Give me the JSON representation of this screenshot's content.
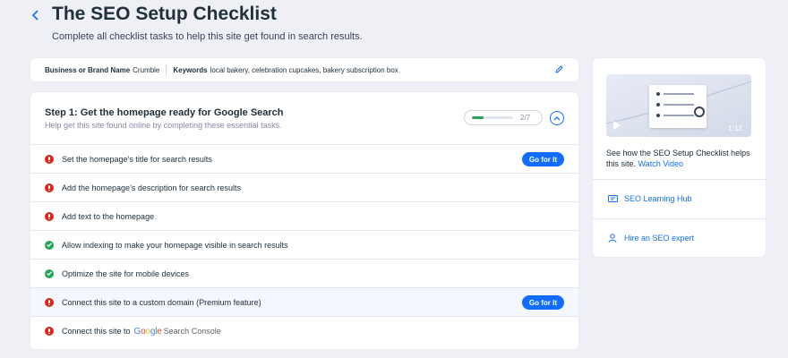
{
  "header": {
    "title": "The SEO Setup Checklist",
    "subtitle": "Complete all checklist tasks to help this site get found in search results."
  },
  "info_bar": {
    "brand_label": "Business or Brand Name",
    "brand_value": "Crumble",
    "keywords_label": "Keywords",
    "keywords_value": "local bakery, celebration cupcakes, bakery subscription box"
  },
  "step": {
    "title": "Step 1: Get the homepage ready for Google Search",
    "subtitle": "Help get this site found online by completing these essential tasks.",
    "progress_text": "2/7",
    "progress_fraction": 0.2857
  },
  "tasks": [
    {
      "label": "Set the homepage’s title for search results",
      "status": "error",
      "button": "Go for It"
    },
    {
      "label": "Add the homepage’s description for search results",
      "status": "error"
    },
    {
      "label": "Add text to the homepage",
      "status": "error"
    },
    {
      "label": "Allow indexing to make your homepage visible in search results",
      "status": "done"
    },
    {
      "label": "Optimize the site for mobile devices",
      "status": "done"
    },
    {
      "label": "Connect this site to a custom domain (Premium feature)",
      "status": "error",
      "button": "Go for It"
    },
    {
      "label": "Connect this site to",
      "status": "error",
      "logo_text": "Google",
      "logo_suffix": "Search Console"
    }
  ],
  "sidebar": {
    "video_duration": "1:12",
    "video_caption": "See how the SEO Setup Checklist helps this site.",
    "video_link": "Watch Video",
    "links": [
      {
        "label": "SEO Learning Hub",
        "icon": "learning-hub-icon"
      },
      {
        "label": "Hire an SEO expert",
        "icon": "expert-icon"
      }
    ]
  },
  "colors": {
    "accent": "#116dff",
    "error": "#e62214",
    "success": "#25a55a",
    "background": "#eef0f5"
  }
}
